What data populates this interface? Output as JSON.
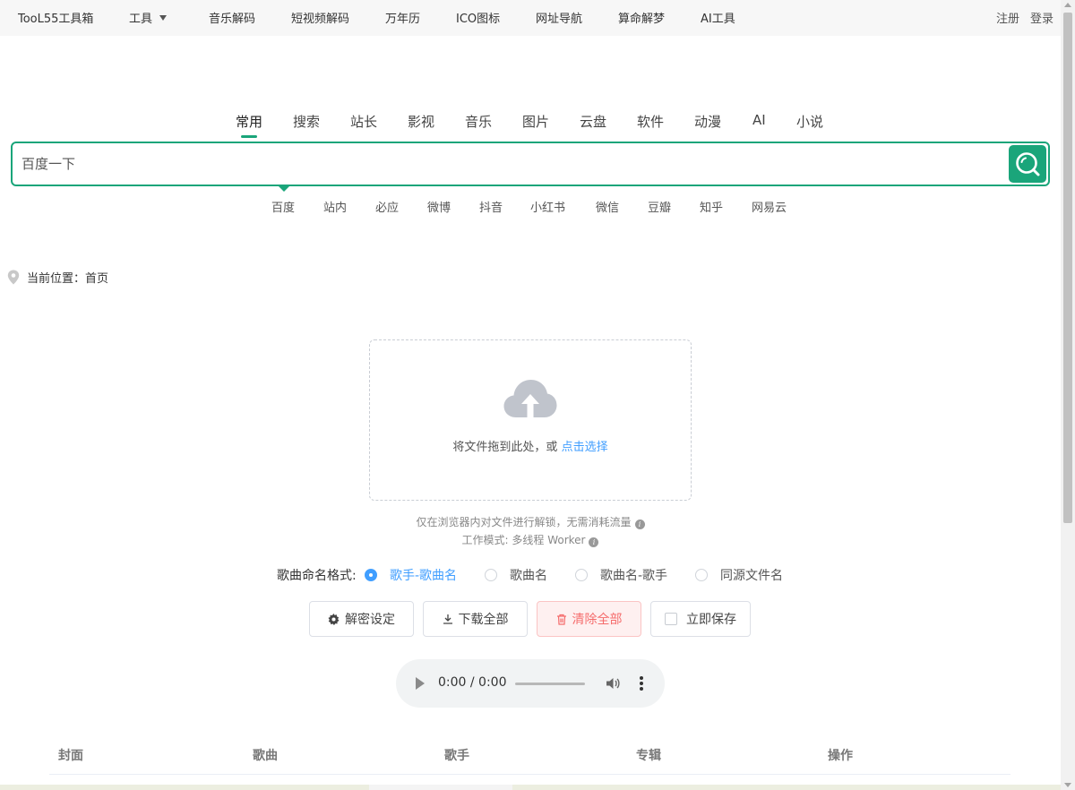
{
  "topnav": {
    "brand": "TooL55工具箱",
    "tools_label": "工具",
    "items": [
      "音乐解码",
      "短视频解码",
      "万年历",
      "ICO图标",
      "网址导航",
      "算命解梦",
      "AI工具"
    ],
    "register": "注册",
    "login": "登录"
  },
  "search": {
    "tabs": [
      "常用",
      "搜索",
      "站长",
      "影视",
      "音乐",
      "图片",
      "云盘",
      "软件",
      "动漫",
      "AI",
      "小说"
    ],
    "active_tab": "常用",
    "placeholder": "百度一下",
    "engines": [
      "百度",
      "站内",
      "必应",
      "微博",
      "抖音",
      "小红书",
      "微信",
      "豆瓣",
      "知乎",
      "网易云"
    ]
  },
  "breadcrumb": {
    "text": "当前位置：首页"
  },
  "upload": {
    "prompt": "将文件拖到此处，或",
    "link": "点击选择",
    "tip1": "仅在浏览器内对文件进行解锁，无需消耗流量",
    "tip2": "工作模式: 多线程 Worker"
  },
  "naming": {
    "label": "歌曲命名格式:",
    "options": [
      "歌手-歌曲名",
      "歌曲名",
      "歌曲名-歌手",
      "同源文件名"
    ],
    "selected": "歌手-歌曲名"
  },
  "actions": {
    "settings": "解密设定",
    "download_all": "下载全部",
    "clear_all": "清除全部",
    "save_now": "立即保存"
  },
  "player": {
    "time": "0:00 / 0:00",
    "progress": 0
  },
  "table": {
    "columns": [
      "封面",
      "歌曲",
      "歌手",
      "专辑",
      "操作"
    ]
  },
  "colors": {
    "accent": "#1aa57a",
    "link": "#409eff",
    "danger": "#f56c6c"
  }
}
